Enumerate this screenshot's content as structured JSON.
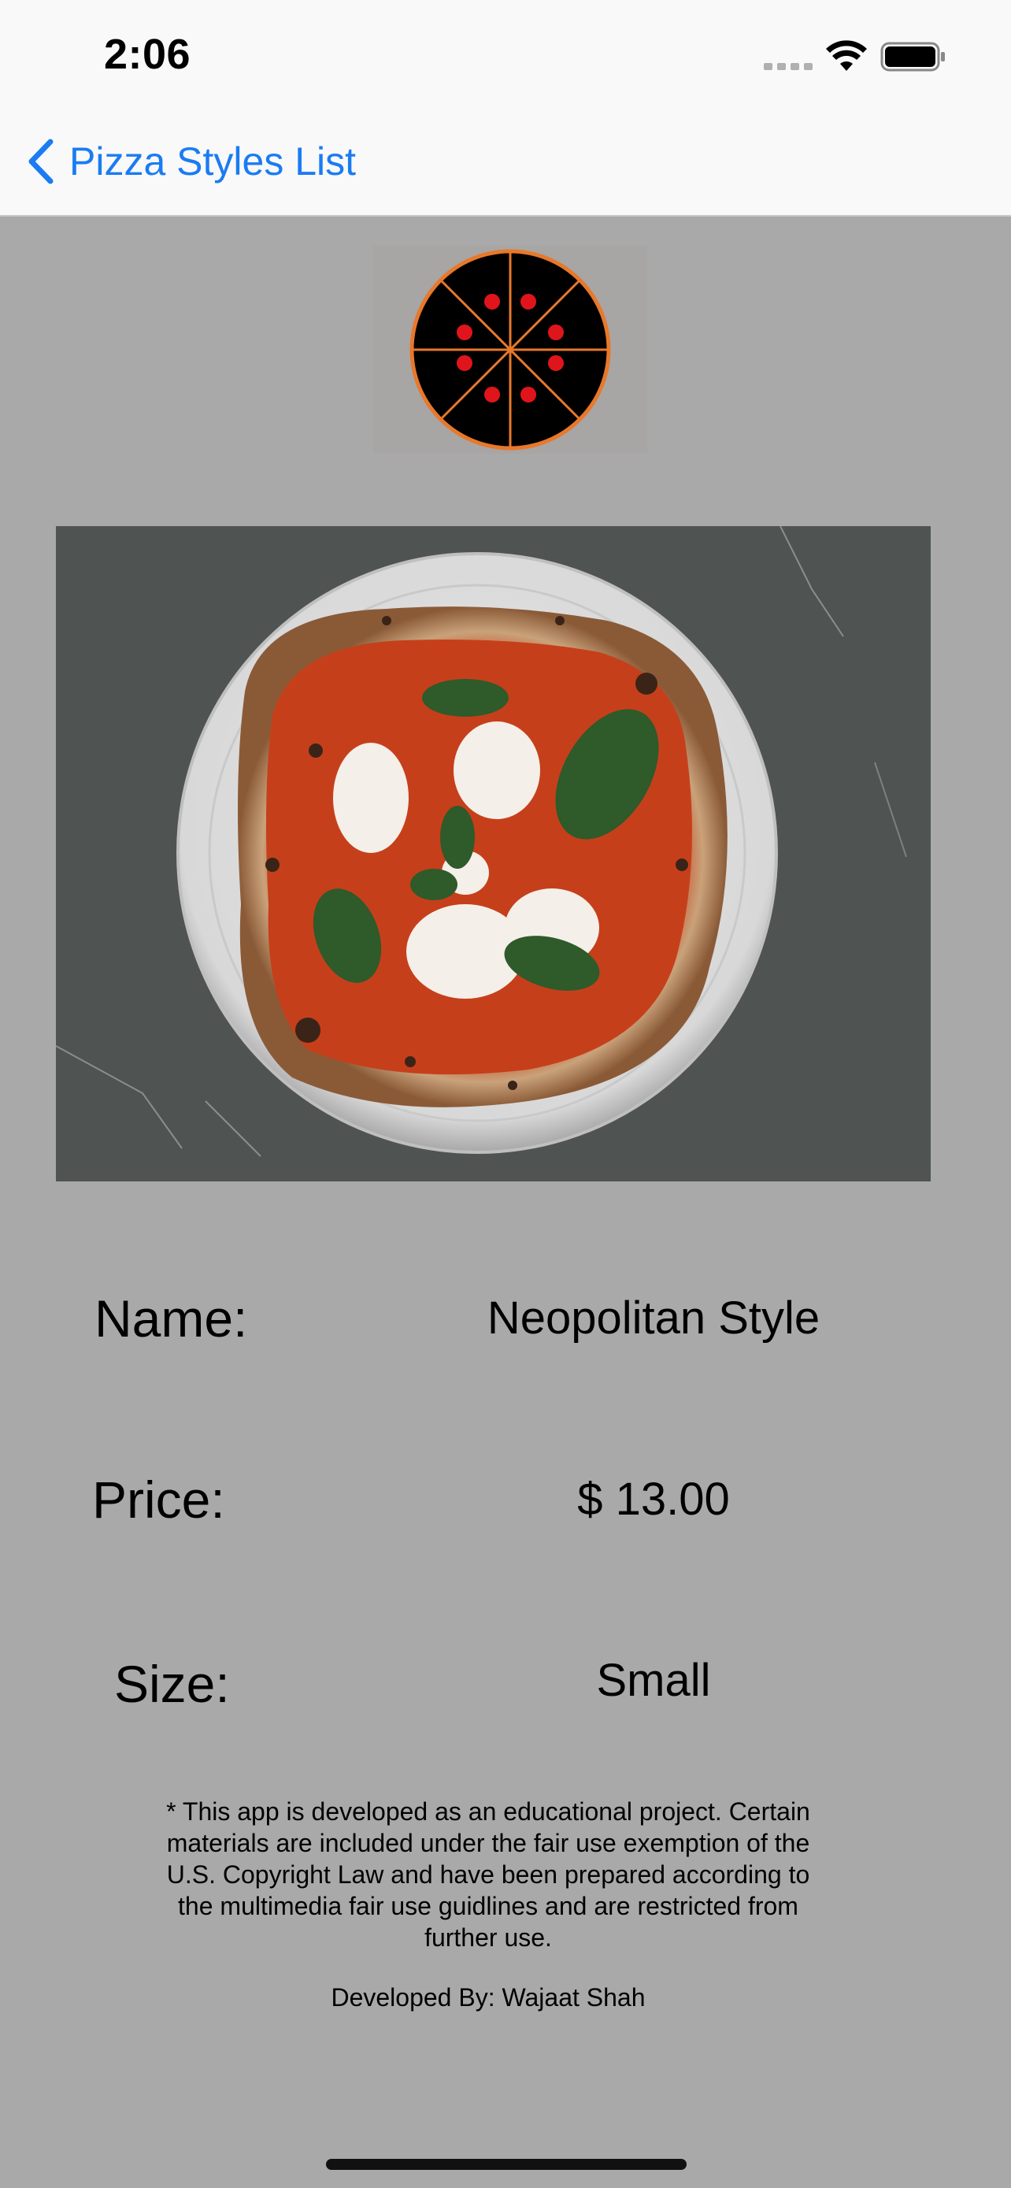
{
  "status_bar": {
    "time": "2:06"
  },
  "nav": {
    "back_label": "Pizza Styles List",
    "accent_color": "#1a7cf2"
  },
  "logo": {
    "icon": "pizza-logo-icon"
  },
  "photo": {
    "icon": "pizza-photo",
    "description_visible": false
  },
  "details": {
    "name_label": "Name:",
    "name_value": "Neopolitan Style",
    "price_label": "Price:",
    "price_value": "$ 13.00",
    "size_label": "Size:",
    "size_value": "Small"
  },
  "footer": {
    "disclaimer": "* This app is developed as an educational project. Certain materials are included under the fair use exemption of the U.S. Copyright Law and have been prepared according to the multimedia fair use guidlines and are restricted from further use.",
    "developer": "Developed By: Wajaat Shah"
  },
  "colors": {
    "background": "#a9a9a9",
    "bar_background": "#f9f9f9"
  }
}
